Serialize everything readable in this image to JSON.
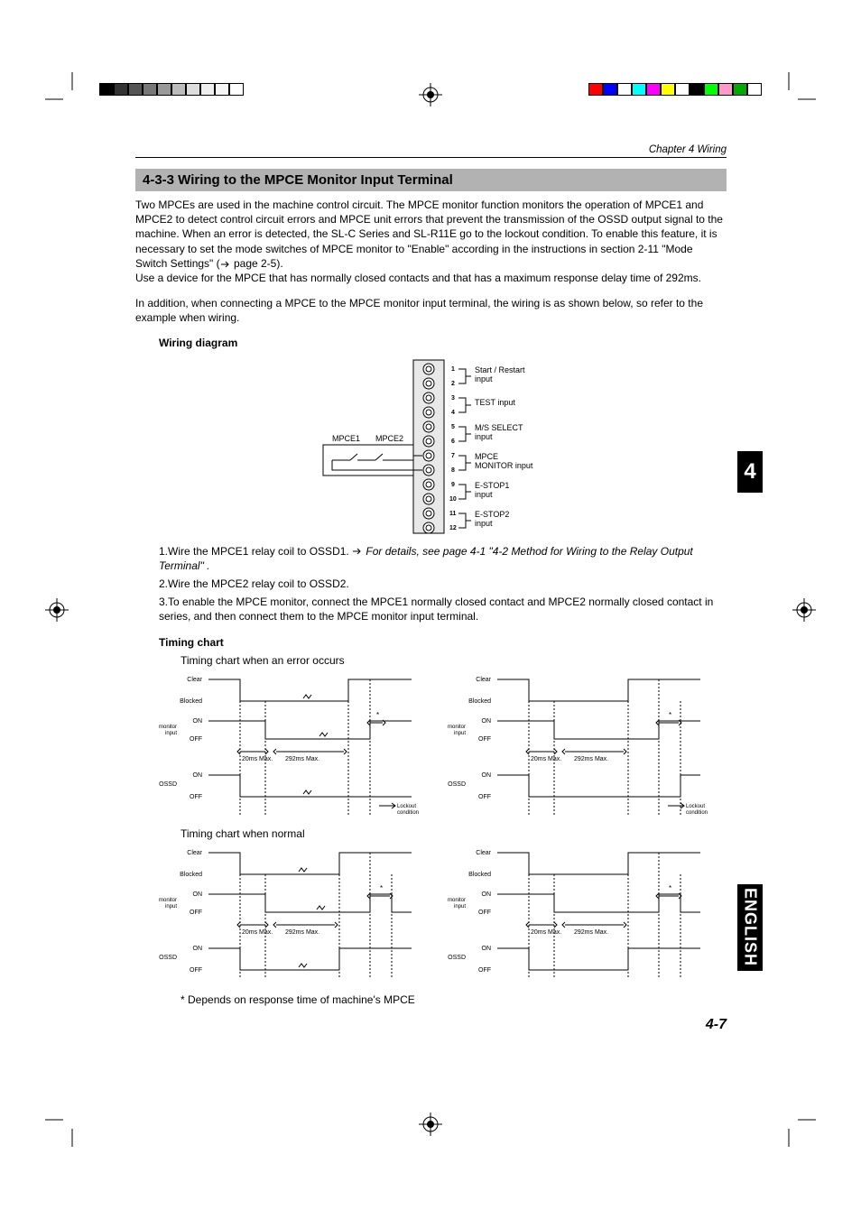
{
  "chapter_header": "Chapter 4  Wiring",
  "section_title": "4-3-3  Wiring to the MPCE Monitor Input Terminal",
  "paragraph_1": "Two MPCEs are used in the machine control circuit. The MPCE monitor function monitors the operation of MPCE1 and MPCE2 to detect control circuit errors and MPCE unit errors that prevent the transmission of the OSSD output signal to the machine. When an error is detected, the SL-C Series and SL-R11E go to the lockout condition. To enable this feature, it is necessary to set the mode switches of MPCE monitor to \"Enable\" according in the instructions in section 2-11 \"Mode Switch Settings\" (",
  "paragraph_1_ref": " page 2-5).",
  "paragraph_1b": "Use a device for the MPCE that has normally closed contacts and that has a maximum response delay time of 292ms.",
  "paragraph_2": "In addition, when connecting a MPCE to the MPCE monitor input terminal, the wiring is as shown below, so refer to the example when wiring.",
  "wiring_diagram_heading": "Wiring diagram",
  "wiring": {
    "mpce1": "MPCE1",
    "mpce2": "MPCE2",
    "terminals": [
      "1",
      "2",
      "3",
      "4",
      "5",
      "6",
      "7",
      "8",
      "9",
      "10",
      "11",
      "12"
    ],
    "labels": [
      "Start / Restart input",
      "TEST input",
      "M/S SELECT input",
      "MPCE MONITOR input",
      "E-STOP1 input",
      "E-STOP2 input"
    ]
  },
  "steps": {
    "s1a": "1.Wire the MPCE1 relay coil to OSSD1. ",
    "s1b": "For details, see page 4-1 \"4-2 Method for Wiring to the Relay Output Terminal\" .",
    "s2": "2.Wire the MPCE2 relay coil to OSSD2.",
    "s3": "3.To enable the MPCE monitor, connect the MPCE1 normally closed contact and MPCE2 normally closed contact in series, and then connect them to the MPCE monitor input terminal."
  },
  "timing_heading": "Timing chart",
  "timing_sub1": "Timing chart when an error occurs",
  "timing_sub2": "Timing chart when normal",
  "timing_labels": {
    "clear": "Clear",
    "blocked": "Blocked",
    "on": "ON",
    "off": "OFF",
    "mpce_input": "MPCE monitor input",
    "ossd": "OSSD",
    "t1": "20ms Max.",
    "t2": "292ms Max.",
    "star": "*",
    "lockout": "Lockout condition"
  },
  "footnote": "* Depends on response time of machine's MPCE",
  "chapter_tab": "4",
  "english_tab": "ENGLISH",
  "page_num": "4-7"
}
